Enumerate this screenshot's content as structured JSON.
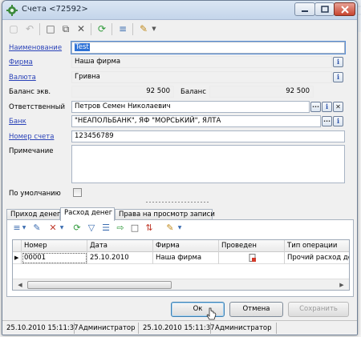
{
  "window": {
    "title": "Счета <72592>"
  },
  "form": {
    "name_label": "Наименование",
    "name_value": "Test",
    "firm_label": "Фирма",
    "firm_value": "Наша фирма",
    "currency_label": "Валюта",
    "currency_value": "Гривна",
    "balance_eq_label": "Баланс экв.",
    "balance_eq_value": "92 500",
    "balance_label": "Баланс",
    "balance_value": "92 500",
    "responsible_label": "Ответственный",
    "responsible_value": "Петров Семен Николаевич",
    "bank_label": "Банк",
    "bank_value": "\"НЕАПОЛЬБАНК\", ЯФ \"МОРСЬКИЙ\", ЯЛТА",
    "account_label": "Номер счета",
    "account_value": "123456789",
    "note_label": "Примечание",
    "note_value": "",
    "default_label": "По умолчанию"
  },
  "tabs": [
    {
      "label": "Приход денег"
    },
    {
      "label": "Расход денег"
    },
    {
      "label": "Права на просмотр записи"
    }
  ],
  "grid": {
    "columns": [
      "Номер",
      "Дата",
      "Фирма",
      "Проведен",
      "Тип операции"
    ],
    "rows": [
      {
        "number": "00001",
        "date": "25.10.2010",
        "firm": "Наша фирма",
        "type": "Прочий расход ден"
      }
    ]
  },
  "buttons": {
    "ok": "Ок",
    "cancel": "Отмена",
    "save": "Сохранить"
  },
  "status": {
    "created": "25.10.2010 15:11:37",
    "created_by": "Администратор",
    "modified": "25.10.2010 15:11:37",
    "modified_by": "Администратор"
  },
  "icons": {
    "info": "i",
    "dots": "...",
    "clear": "✕"
  }
}
